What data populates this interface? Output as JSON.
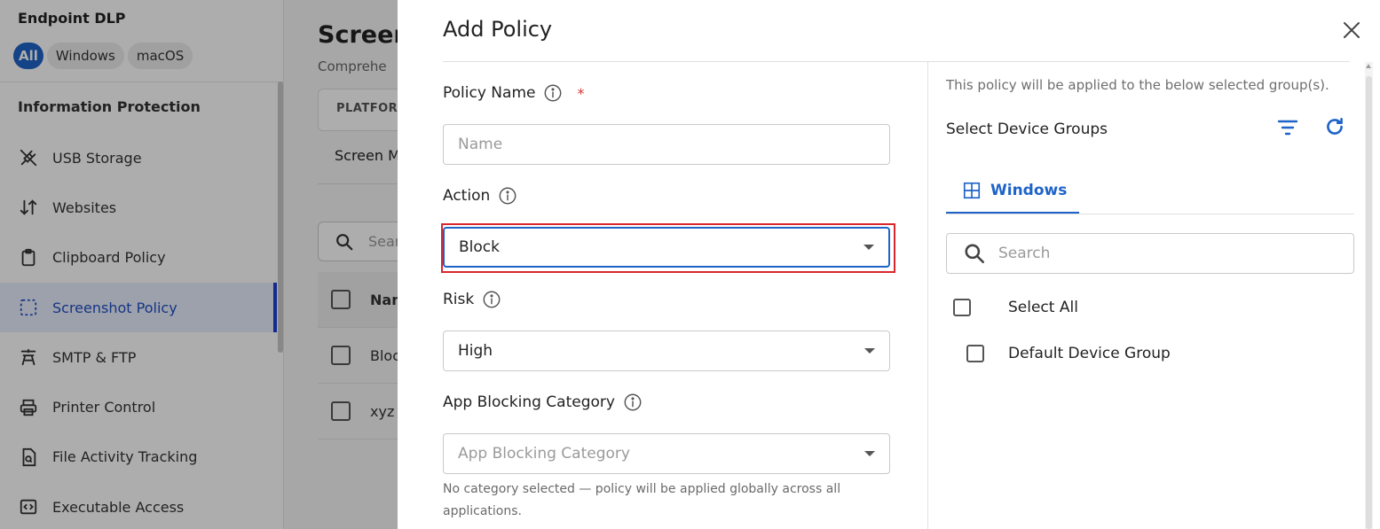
{
  "sidebar": {
    "title": "Endpoint DLP",
    "platform_chips": [
      "All",
      "Windows",
      "macOS"
    ],
    "section_title": "Information Protection",
    "items": [
      {
        "label": "USB Storage",
        "icon": "usb-icon"
      },
      {
        "label": "Websites",
        "icon": "sort-arrows-icon"
      },
      {
        "label": "Clipboard Policy",
        "icon": "clipboard-icon"
      },
      {
        "label": "Screenshot Policy",
        "icon": "screenshot-icon",
        "active": true
      },
      {
        "label": "SMTP & FTP",
        "icon": "tower-icon"
      },
      {
        "label": "Printer Control",
        "icon": "printer-icon"
      },
      {
        "label": "File Activity Tracking",
        "icon": "file-search-icon"
      },
      {
        "label": "Executable Access",
        "icon": "executable-icon"
      }
    ]
  },
  "main": {
    "title": "Screen",
    "subtitle": "Comprehe",
    "platform_header": "PLATFOR",
    "tab_label": "Screen M",
    "search_placeholder": "Sear",
    "table": {
      "header": "Nan",
      "rows": [
        "Bloc",
        "xyz"
      ]
    }
  },
  "drawer": {
    "title": "Add Policy",
    "policy_name": {
      "label": "Policy Name",
      "required_mark": "*",
      "placeholder": "Name",
      "value": ""
    },
    "action": {
      "label": "Action",
      "value": "Block"
    },
    "risk": {
      "label": "Risk",
      "value": "High"
    },
    "app_blocking": {
      "label": "App Blocking Category",
      "placeholder": "App Blocking Category",
      "hint": "No category selected — policy will be applied globally across all applications."
    },
    "right_panel": {
      "note": "This policy will be applied to the below selected group(s).",
      "title": "Select Device Groups",
      "tab": "Windows",
      "search_placeholder": "Search",
      "select_all": "Select All",
      "groups": [
        "Default Device Group"
      ]
    }
  },
  "colors": {
    "accent": "#1e63c8",
    "highlight": "#d8262c",
    "required": "#d93636"
  }
}
